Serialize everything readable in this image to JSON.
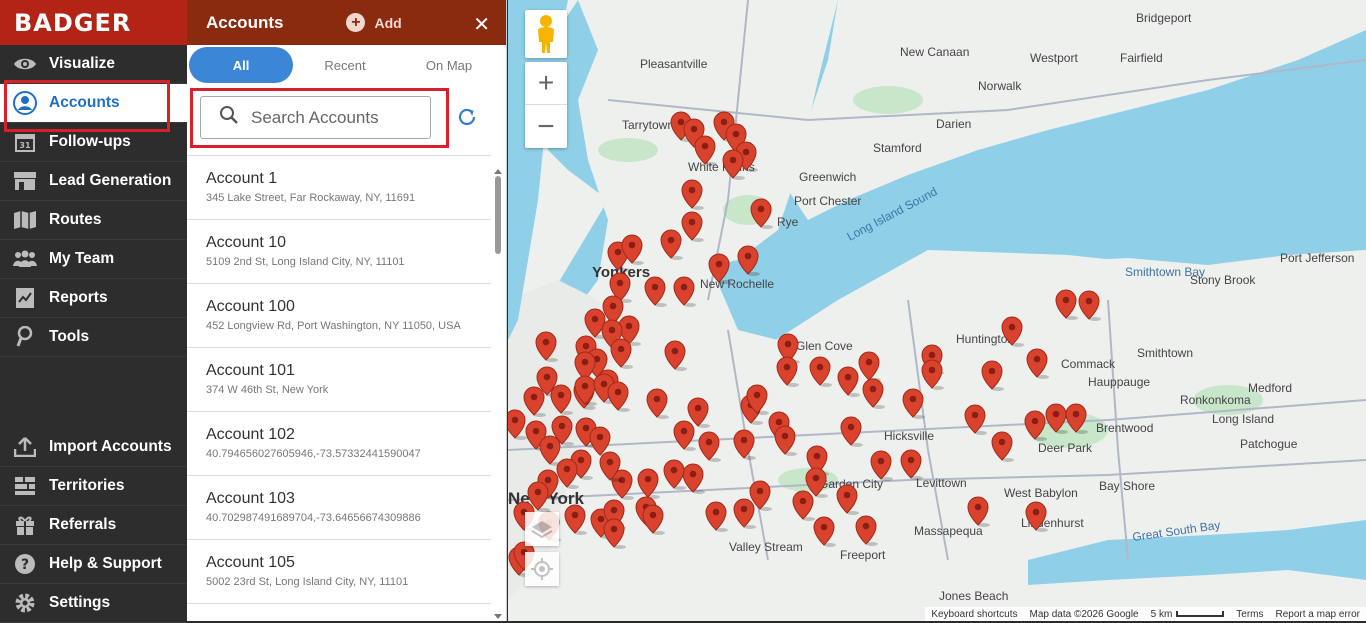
{
  "app": {
    "logo": "BADGER"
  },
  "nav": [
    {
      "label": "Visualize",
      "icon": "eye-icon"
    },
    {
      "label": "Accounts",
      "icon": "user-circle-icon",
      "active": true
    },
    {
      "label": "Follow-ups",
      "icon": "calendar-icon",
      "badge": "31"
    },
    {
      "label": "Lead Generation",
      "icon": "store-icon"
    },
    {
      "label": "Routes",
      "icon": "map-icon"
    },
    {
      "label": "My Team",
      "icon": "team-icon"
    },
    {
      "label": "Reports",
      "icon": "reports-icon"
    },
    {
      "label": "Tools",
      "icon": "tools-icon"
    }
  ],
  "nav_bottom": [
    {
      "label": "Import Accounts",
      "icon": "upload-icon"
    },
    {
      "label": "Territories",
      "icon": "territories-icon"
    },
    {
      "label": "Referrals",
      "icon": "gift-icon"
    },
    {
      "label": "Help & Support",
      "icon": "help-icon"
    },
    {
      "label": "Settings",
      "icon": "gear-icon"
    }
  ],
  "panel": {
    "title": "Accounts",
    "add_label": "Add",
    "close": "✕",
    "tabs": [
      "All",
      "Recent",
      "On Map"
    ],
    "search_placeholder": "Search Accounts"
  },
  "accounts": [
    {
      "name": "Account 1",
      "address": "345 Lake Street, Far Rockaway, NY, 11691"
    },
    {
      "name": "Account 10",
      "address": "5109 2nd St, Long Island City, NY, 11101"
    },
    {
      "name": "Account 100",
      "address": "452 Longview Rd, Port Washington, NY 11050, USA"
    },
    {
      "name": "Account 101",
      "address": "374 W 46th St, New York"
    },
    {
      "name": "Account 102",
      "address": "40.794656027605946,-73.57332441590047"
    },
    {
      "name": "Account 103",
      "address": "40.702987491689704,-73.64656674309886"
    },
    {
      "name": "Account 105",
      "address": "5002 23rd St, Long Island City, NY, 11101"
    }
  ],
  "map": {
    "labels": [
      "Bridgeport",
      "New Canaan",
      "Westport",
      "Fairfield",
      "Pleasantville",
      "Norwalk",
      "Tarrytown",
      "Darien",
      "Stamford",
      "Greenwich",
      "Port Chester",
      "Rye",
      "Yonkers",
      "Smithtown Bay",
      "Port Jefferson",
      "Stony Brook",
      "Glen Cove",
      "Huntington",
      "Smithtown",
      "Commack",
      "Hauppauge",
      "Medford",
      "Ronkonkoma",
      "Long Island",
      "Hicksville",
      "Brentwood",
      "Deer Park",
      "Patchogue",
      "West Babylon",
      "Bay Shore",
      "Levittown",
      "Massapequa",
      "Lindenhurst",
      "Valley Stream",
      "Freeport",
      "Great South Bay",
      "Jones Beach",
      "New York",
      "Garden City",
      "Long Island Sound",
      "White Plains",
      "New Rochelle"
    ],
    "attribution": [
      "Keyboard shortcuts",
      "Map data ©2026 Google",
      "5 km",
      "Terms",
      "Report a map error"
    ]
  },
  "colors": {
    "brand_red": "#b32417",
    "panel_header": "#8a2b10",
    "accent_blue": "#3b87d6",
    "pin_red": "#d9432e"
  }
}
